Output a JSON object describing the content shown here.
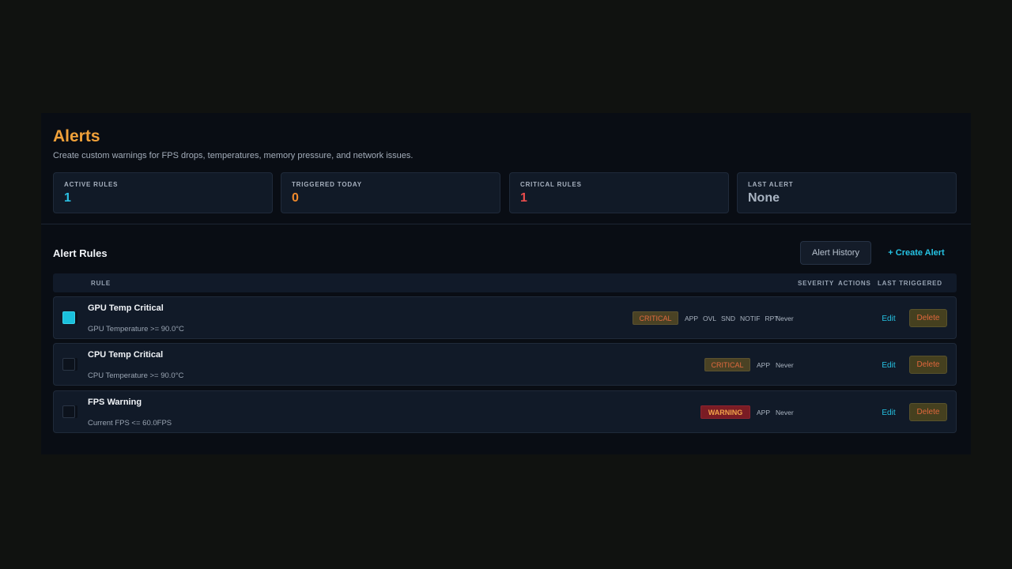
{
  "header": {
    "title": "Alerts",
    "subtitle": "Create custom warnings for FPS drops, temperatures, memory pressure, and network issues."
  },
  "stats": [
    {
      "label": "ACTIVE RULES",
      "value": "1",
      "color": "#2bbfe2"
    },
    {
      "label": "TRIGGERED TODAY",
      "value": "0",
      "color": "#f08a2c"
    },
    {
      "label": "CRITICAL RULES",
      "value": "1",
      "color": "#ec4d4d"
    },
    {
      "label": "LAST ALERT",
      "value": "None",
      "color": "#a9b4c2"
    }
  ],
  "section": {
    "title": "Alert Rules",
    "history_button": "Alert History",
    "create_button": "+ Create Alert"
  },
  "table": {
    "headers": {
      "rule": "RULE",
      "severity": "SEVERITY",
      "actions": "ACTIONS",
      "last_triggered": "LAST TRIGGERED"
    }
  },
  "rows": [
    {
      "enabled": true,
      "name": "GPU Temp Critical",
      "condition": "GPU Temperature >= 90.0°C",
      "severity": "CRITICAL",
      "actions": [
        "APP",
        "OVL",
        "SND",
        "NOTIF",
        "RPT"
      ],
      "last_triggered": "Never",
      "edit": "Edit",
      "delete": "Delete"
    },
    {
      "enabled": false,
      "name": "CPU Temp Critical",
      "condition": "CPU Temperature >= 90.0°C",
      "severity": "CRITICAL",
      "actions": [
        "APP"
      ],
      "last_triggered": "Never",
      "edit": "Edit",
      "delete": "Delete"
    },
    {
      "enabled": false,
      "name": "FPS Warning",
      "condition": "Current FPS <= 60.0FPS",
      "severity": "WARNING",
      "actions": [
        "APP"
      ],
      "last_triggered": "Never",
      "edit": "Edit",
      "delete": "Delete"
    }
  ],
  "colors": {
    "accent": "#25c3e4",
    "title": "#f0a13a",
    "critical_text": "#e16a3f",
    "warning_bg": "#7a1c24"
  }
}
